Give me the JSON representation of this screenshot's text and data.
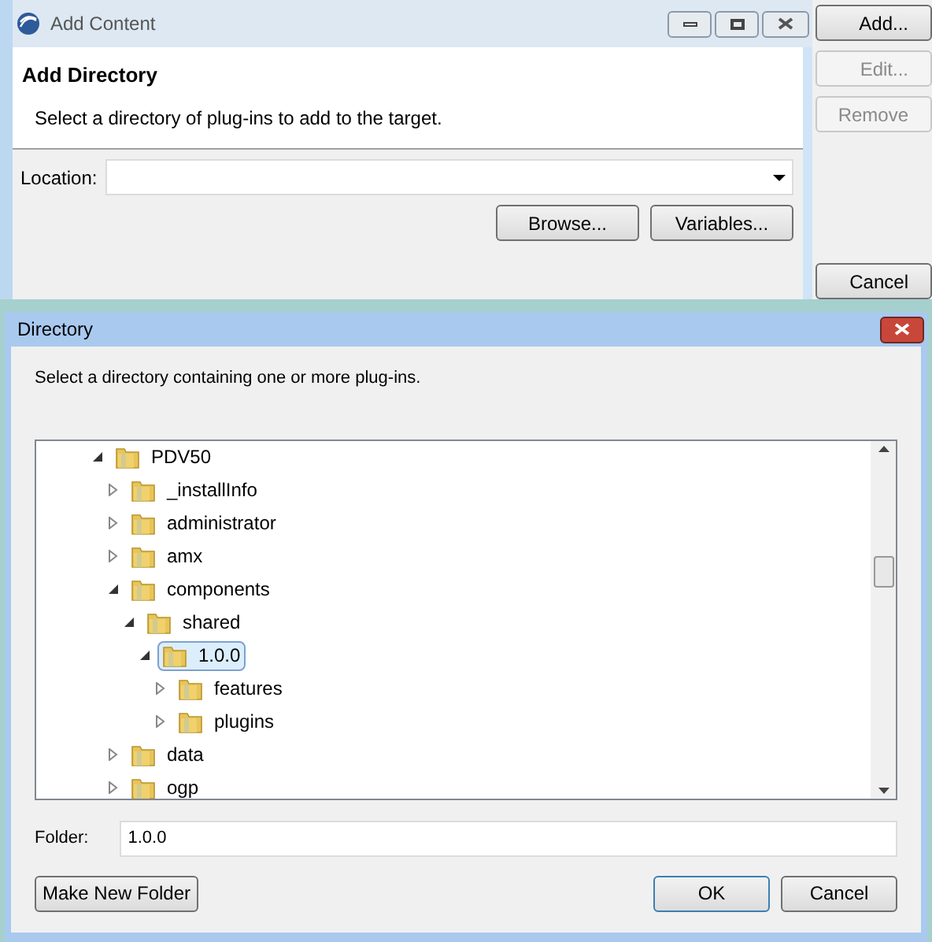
{
  "back_window": {
    "title": "Add Content",
    "heading": "Add Directory",
    "description": "Select a directory of plug-ins to add to the target.",
    "location": {
      "label": "Location:"
    },
    "buttons": [
      "Browse...",
      "Variables..."
    ]
  },
  "side_buttons": [
    {
      "label": "Add...",
      "disabled": false
    },
    {
      "label": "Edit...",
      "disabled": true
    },
    {
      "label": "Remove",
      "disabled": true
    },
    {
      "label": "Cancel",
      "disabled": false
    }
  ],
  "dialog": {
    "title": "Directory",
    "description": "Select a directory containing one or more plug-ins.",
    "tree": [
      {
        "label": "PDV50",
        "expanded": true,
        "selected": false,
        "children": [
          {
            "label": "_installInfo",
            "expanded": false,
            "selected": false
          },
          {
            "label": "administrator",
            "expanded": false,
            "selected": false
          },
          {
            "label": "amx",
            "expanded": false,
            "selected": false
          },
          {
            "label": "components",
            "expanded": true,
            "selected": false,
            "children": [
              {
                "label": "shared",
                "expanded": true,
                "selected": false,
                "children": [
                  {
                    "label": "1.0.0",
                    "expanded": true,
                    "selected": true,
                    "children": [
                      {
                        "label": "features",
                        "expanded": false,
                        "selected": false
                      },
                      {
                        "label": "plugins",
                        "expanded": false,
                        "selected": false
                      }
                    ]
                  }
                ]
              }
            ]
          },
          {
            "label": "data",
            "expanded": false,
            "selected": false
          },
          {
            "label": "ogp",
            "expanded": false,
            "selected": false
          }
        ]
      }
    ],
    "folder": {
      "label": "Folder:",
      "value": "1.0.0"
    },
    "left_buttons": [
      "Make New Folder"
    ],
    "right_buttons": [
      {
        "label": "OK",
        "default": true
      },
      {
        "label": "Cancel",
        "default": false
      }
    ]
  }
}
